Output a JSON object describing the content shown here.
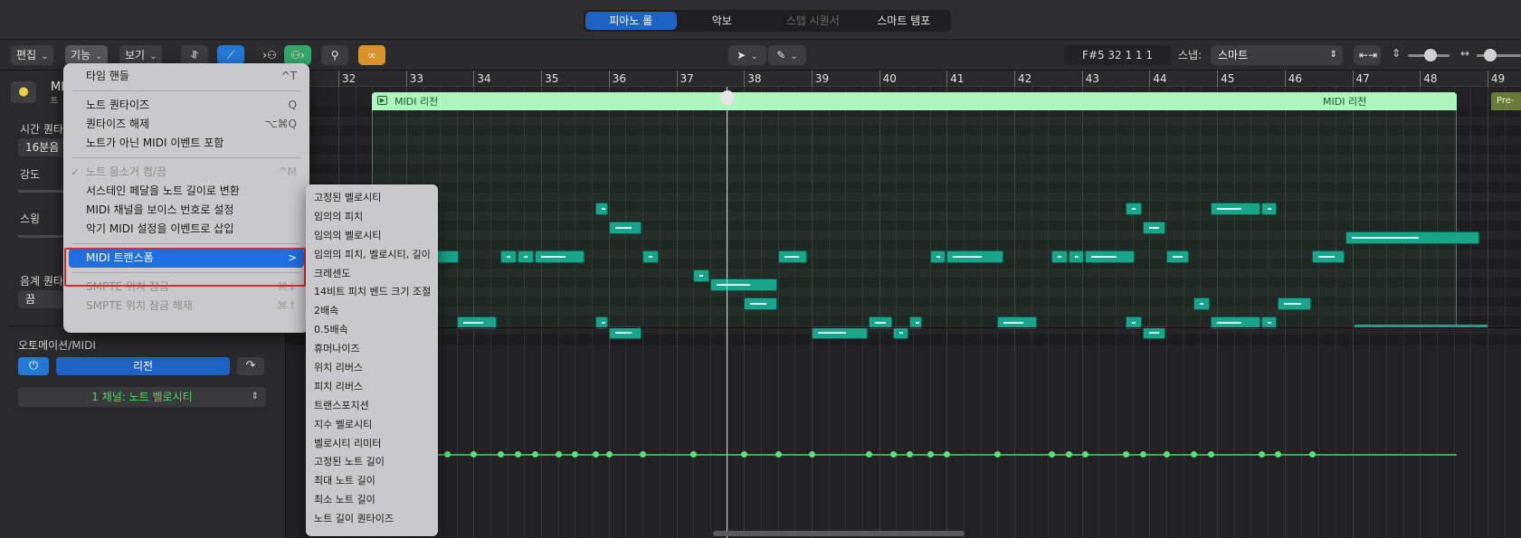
{
  "view_tabs": {
    "piano_roll": "피아노 롤",
    "score": "악보",
    "step_sequencer": "스텝 시퀀서",
    "smart_tempo": "스마트 템포"
  },
  "toolbar": {
    "edit": "편집",
    "functions": "기능",
    "view": "보기",
    "position": "F#5   32 1 1 1",
    "snap_label": "스냅:",
    "snap_value": "스마트"
  },
  "inspector": {
    "title": "MI",
    "subtitle": "트",
    "time_quantize_label": "시간 퀀타",
    "time_quantize_value": "16분음",
    "strength_label": "강도",
    "swing_label": "스윙",
    "scale_quantize_label": "음계 퀀타",
    "scale_value": "끔",
    "automation_label": "오토메이션/MIDI",
    "region_button": "리전",
    "channel_select": "1 채널: 노트 벨로시티"
  },
  "ruler": {
    "bars": [
      "32",
      "33",
      "34",
      "35",
      "36",
      "37",
      "38",
      "39",
      "40",
      "41",
      "42",
      "43",
      "44",
      "45",
      "46",
      "47",
      "48",
      "49"
    ]
  },
  "region": {
    "label_1": "MIDI 리전",
    "label_2": "MIDI 리전",
    "pre_tag": "Pre-"
  },
  "functions_menu": {
    "items": [
      {
        "label": "타임 핸들",
        "shortcut": "^T"
      },
      {
        "label": "노트 퀀타이즈",
        "shortcut": "Q"
      },
      {
        "label": "퀀타이즈 해제",
        "shortcut": "⌥⌘Q"
      },
      {
        "label": "노트가 아닌 MIDI 이벤트 포함",
        "shortcut": ""
      },
      {
        "label": "노트 음소거 켬/끔",
        "shortcut": "^M"
      },
      {
        "label": "서스테인 페달을 노트 길이로 변환",
        "shortcut": ""
      },
      {
        "label": "MIDI 채널을 보이스 번호로 설정",
        "shortcut": ""
      },
      {
        "label": "악기 MIDI 설정을 이벤트로 삽입",
        "shortcut": ""
      },
      {
        "label": "MIDI 트랜스폼",
        "shortcut": ">"
      },
      {
        "label": "SMPTE 위치 잠금",
        "shortcut": "⌘↓"
      },
      {
        "label": "SMPTE 위치 잠금 해제",
        "shortcut": "⌘↑"
      }
    ],
    "checkmark": "✓"
  },
  "transform_submenu": {
    "items": [
      "고정된 벨로시티",
      "임의의 피치",
      "임의의 벨로시티",
      "임의의 피치, 벨로시티, 길이",
      "크레센도",
      "14비트 피치 벤드 크기 조절",
      "2배속",
      "0.5배속",
      "휴머나이즈",
      "위치 리버스",
      "피치 리버스",
      "트랜스포지션",
      "지수 벨로시티",
      "벨로시티 리미터",
      "고정된 노트 길이",
      "최대 노트 길이",
      "최소 노트 길이",
      "노트 길이 퀀타이즈"
    ]
  },
  "notes": [
    {
      "start": 35.8,
      "len": 0.2,
      "pitch": 12
    },
    {
      "start": 36.0,
      "len": 0.5,
      "pitch": 14
    },
    {
      "start": 32.5,
      "len": 0.2,
      "pitch": 17
    },
    {
      "start": 32.7,
      "len": 0.25,
      "pitch": 17
    },
    {
      "start": 32.95,
      "len": 0.85,
      "pitch": 17
    },
    {
      "start": 34.4,
      "len": 0.25,
      "pitch": 17
    },
    {
      "start": 34.65,
      "len": 0.25,
      "pitch": 17
    },
    {
      "start": 34.9,
      "len": 0.75,
      "pitch": 17
    },
    {
      "start": 36.5,
      "len": 0.25,
      "pitch": 17
    },
    {
      "start": 37.25,
      "len": 0.25,
      "pitch": 19
    },
    {
      "start": 37.5,
      "len": 1.0,
      "pitch": 20
    },
    {
      "start": 38.0,
      "len": 0.5,
      "pitch": 22
    },
    {
      "start": 33.75,
      "len": 0.6,
      "pitch": 24
    },
    {
      "start": 35.8,
      "len": 0.2,
      "pitch": 24
    },
    {
      "start": 36.0,
      "len": 0.5,
      "pitch": 25
    },
    {
      "start": 38.5,
      "len": 0.45,
      "pitch": 17
    },
    {
      "start": 39.0,
      "len": 0.85,
      "pitch": 25
    },
    {
      "start": 39.85,
      "len": 0.35,
      "pitch": 24
    },
    {
      "start": 40.2,
      "len": 0.25,
      "pitch": 25
    },
    {
      "start": 40.45,
      "len": 0.2,
      "pitch": 24
    },
    {
      "start": 40.75,
      "len": 0.25,
      "pitch": 17
    },
    {
      "start": 41.0,
      "len": 0.85,
      "pitch": 17
    },
    {
      "start": 41.75,
      "len": 0.6,
      "pitch": 24
    },
    {
      "start": 42.55,
      "len": 0.25,
      "pitch": 17
    },
    {
      "start": 42.8,
      "len": 0.25,
      "pitch": 17
    },
    {
      "start": 43.05,
      "len": 0.75,
      "pitch": 17
    },
    {
      "start": 43.65,
      "len": 0.25,
      "pitch": 24
    },
    {
      "start": 43.65,
      "len": 0.25,
      "pitch": 12
    },
    {
      "start": 43.9,
      "len": 0.35,
      "pitch": 14
    },
    {
      "start": 43.9,
      "len": 0.35,
      "pitch": 25
    },
    {
      "start": 44.25,
      "len": 0.35,
      "pitch": 17
    },
    {
      "start": 44.65,
      "len": 0.25,
      "pitch": 22
    },
    {
      "start": 44.9,
      "len": 0.75,
      "pitch": 12
    },
    {
      "start": 44.9,
      "len": 0.75,
      "pitch": 24
    },
    {
      "start": 45.65,
      "len": 0.25,
      "pitch": 12
    },
    {
      "start": 45.65,
      "len": 0.25,
      "pitch": 24
    },
    {
      "start": 45.9,
      "len": 0.5,
      "pitch": 22
    },
    {
      "start": 46.4,
      "len": 0.5,
      "pitch": 17
    },
    {
      "start": 46.9,
      "len": 2.0,
      "pitch": 15
    }
  ],
  "velocity_points": [
    33.6,
    34.0,
    34.4,
    34.65,
    34.9,
    35.25,
    35.5,
    35.8,
    36.0,
    36.5,
    37.25,
    38.0,
    38.5,
    39.0,
    39.85,
    40.2,
    40.45,
    40.75,
    41.0,
    41.75,
    42.55,
    42.8,
    43.05,
    43.65,
    43.9,
    44.25,
    44.65,
    44.9,
    45.65,
    45.9,
    46.4
  ]
}
